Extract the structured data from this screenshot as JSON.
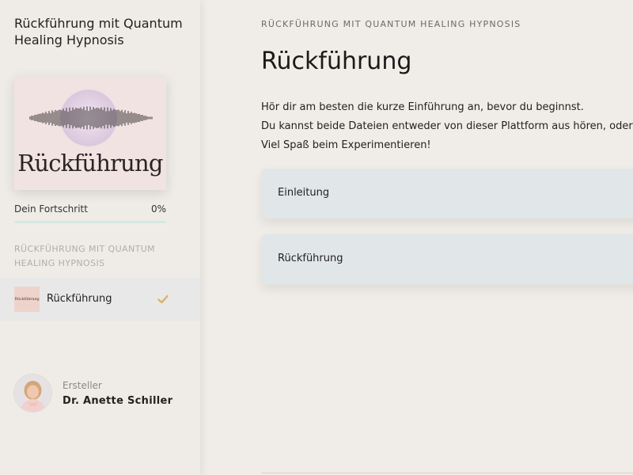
{
  "sidebar": {
    "course_title": "Rückführung mit Quantum Healing Hypnosis",
    "cover": {
      "title": "Rückführung"
    },
    "progress": {
      "label": "Dein Fortschritt",
      "value_text": "0%",
      "fraction": 0
    },
    "section_heading": "RÜCKFÜHRUNG MIT QUANTUM HEALING HYPNOSIS",
    "lesson": {
      "label": "Rückführung",
      "thumb_text": "Rückführung",
      "completed": true
    },
    "creator": {
      "role": "Ersteller",
      "name": "Dr. Anette Schiller"
    }
  },
  "main": {
    "eyebrow": "RÜCKFÜHRUNG MIT QUANTUM HEALING HYPNOSIS",
    "title": "Rückführung",
    "description_lines": [
      "Hör dir am besten die kurze Einführung an, bevor du beginnst.",
      "Du kannst beide Dateien entweder von dieser Plattform aus hören, oder",
      "Viel Spaß beim Experimentieren!"
    ],
    "lessons": [
      {
        "label": "Einleitung"
      },
      {
        "label": "Rückführung"
      }
    ]
  },
  "colors": {
    "background": "#f0ede8",
    "card": "#e1e6e8",
    "progress_track": "#d6e8e3",
    "check_accent": "#d9b36a",
    "cover_bg": "#f1e3e2"
  },
  "icons": {
    "lesson_done": "check-icon"
  }
}
